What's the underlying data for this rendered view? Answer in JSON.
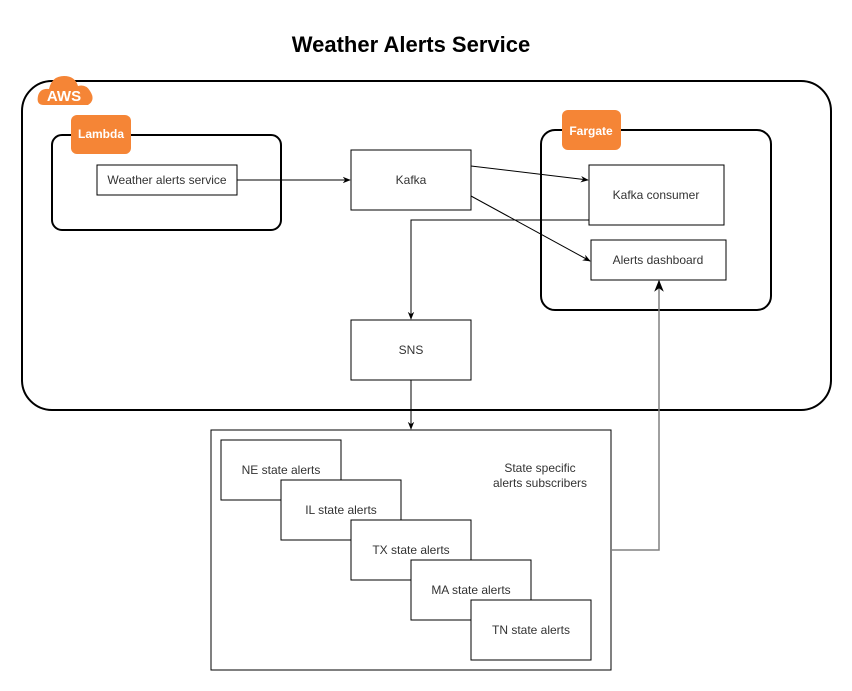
{
  "title": "Weather Alerts Service",
  "colors": {
    "aws_orange": "#F58536",
    "stroke": "#000000",
    "text": "#333333"
  },
  "groups": {
    "aws": {
      "label": "AWS",
      "icon": "aws-cloud-icon"
    },
    "lambda": {
      "label": "Lambda"
    },
    "fargate": {
      "label": "Fargate"
    },
    "subscribers": {
      "label": "State specific alerts subscribers",
      "label_lines": [
        "State specific",
        "alerts subscribers"
      ]
    }
  },
  "nodes": {
    "weather_service": "Weather alerts service",
    "kafka": "Kafka",
    "kafka_consumer": "Kafka consumer",
    "alerts_dashboard": "Alerts dashboard",
    "sns": "SNS",
    "states": [
      "NE state alerts",
      "IL state alerts",
      "TX state alerts",
      "MA state alerts",
      "TN state alerts"
    ]
  },
  "edges": [
    {
      "from": "Weather alerts service",
      "to": "Kafka"
    },
    {
      "from": "Kafka",
      "to": "Kafka consumer"
    },
    {
      "from": "Kafka",
      "to": "Alerts dashboard"
    },
    {
      "from": "Kafka consumer",
      "to": "SNS"
    },
    {
      "from": "SNS",
      "to": "State specific alerts subscribers"
    },
    {
      "from": "State specific alerts subscribers",
      "to": "Alerts dashboard"
    }
  ]
}
